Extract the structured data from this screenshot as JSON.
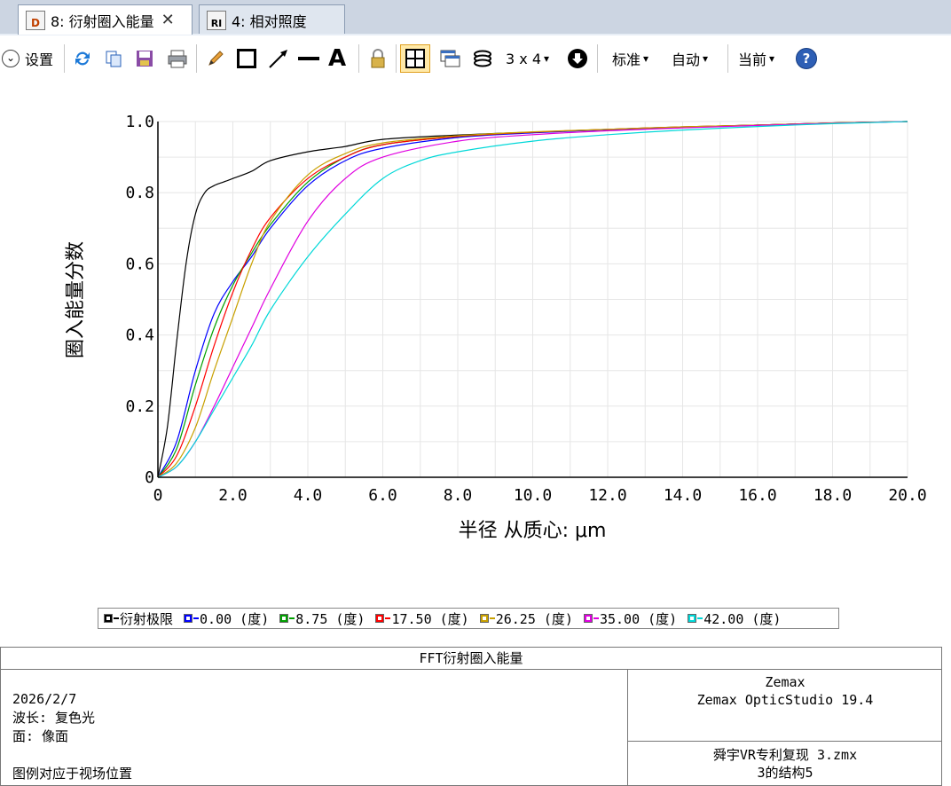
{
  "tabs": [
    {
      "icon": "D",
      "label": "8: 衍射圈入能量",
      "close": "✕"
    },
    {
      "icon": "RI",
      "label": "4: 相对照度"
    }
  ],
  "toolbar": {
    "settings_label": "设置",
    "grid_label": "3 x 4",
    "standard_label": "标准",
    "auto_label": "自动",
    "current_label": "当前",
    "dropdown_arrow": "▾",
    "text_tool": "A",
    "help": "?"
  },
  "chart_data": {
    "type": "line",
    "title": "",
    "xlabel": "半径  从质心: μm",
    "ylabel": "圈入能量分数",
    "xlim": [
      0,
      20
    ],
    "ylim": [
      0,
      1
    ],
    "grid": true,
    "x_ticks": [
      "0",
      "2.0",
      "4.0",
      "6.0",
      "8.0",
      "10.0",
      "12.0",
      "14.0",
      "16.0",
      "18.0",
      "20.0"
    ],
    "y_ticks": [
      "0",
      "0.2",
      "0.4",
      "0.6",
      "0.8",
      "1.0"
    ],
    "series": [
      {
        "name": "衍射极限",
        "color": "#000000",
        "x": [
          0,
          0.25,
          0.5,
          0.75,
          1,
          1.25,
          1.5,
          1.75,
          2,
          2.5,
          3,
          4,
          5,
          6,
          8,
          10,
          12,
          14,
          16,
          18,
          20
        ],
        "y": [
          0,
          0.14,
          0.38,
          0.6,
          0.74,
          0.8,
          0.82,
          0.83,
          0.84,
          0.86,
          0.89,
          0.915,
          0.93,
          0.95,
          0.962,
          0.97,
          0.977,
          0.984,
          0.99,
          0.996,
          1.0
        ]
      },
      {
        "name": "0.00 (度)",
        "color": "#0000ff",
        "x": [
          0,
          0.5,
          1,
          1.5,
          2,
          2.5,
          3,
          4,
          5,
          6,
          8,
          10,
          12,
          14,
          16,
          18,
          20
        ],
        "y": [
          0,
          0.1,
          0.3,
          0.46,
          0.55,
          0.62,
          0.7,
          0.82,
          0.89,
          0.925,
          0.955,
          0.968,
          0.977,
          0.984,
          0.99,
          0.996,
          1.0
        ]
      },
      {
        "name": "8.75 (度)",
        "color": "#00a000",
        "x": [
          0,
          0.5,
          1,
          1.5,
          2,
          2.5,
          3,
          4,
          5,
          6,
          8,
          10,
          12,
          14,
          16,
          18,
          20
        ],
        "y": [
          0,
          0.08,
          0.26,
          0.42,
          0.54,
          0.63,
          0.71,
          0.83,
          0.9,
          0.935,
          0.958,
          0.97,
          0.978,
          0.985,
          0.99,
          0.996,
          1.0
        ]
      },
      {
        "name": "17.50 (度)",
        "color": "#ff0000",
        "x": [
          0,
          0.5,
          1,
          1.5,
          2,
          2.5,
          3,
          4,
          5,
          6,
          8,
          10,
          12,
          14,
          16,
          18,
          20
        ],
        "y": [
          0,
          0.06,
          0.2,
          0.37,
          0.52,
          0.64,
          0.73,
          0.84,
          0.9,
          0.935,
          0.958,
          0.97,
          0.978,
          0.985,
          0.99,
          0.996,
          1.0
        ]
      },
      {
        "name": "26.25 (度)",
        "color": "#c8a000",
        "x": [
          0,
          0.5,
          1,
          1.5,
          2,
          2.5,
          3,
          4,
          5,
          6,
          8,
          10,
          12,
          14,
          16,
          18,
          20
        ],
        "y": [
          0,
          0.04,
          0.14,
          0.3,
          0.45,
          0.6,
          0.72,
          0.85,
          0.91,
          0.94,
          0.96,
          0.971,
          0.978,
          0.985,
          0.99,
          0.996,
          1.0
        ]
      },
      {
        "name": "35.00 (度)",
        "color": "#e000e0",
        "x": [
          0,
          0.5,
          1,
          1.5,
          2,
          2.5,
          3,
          4,
          5,
          6,
          8,
          10,
          12,
          14,
          16,
          18,
          20
        ],
        "y": [
          0,
          0.03,
          0.1,
          0.2,
          0.31,
          0.42,
          0.53,
          0.72,
          0.84,
          0.9,
          0.945,
          0.963,
          0.974,
          0.982,
          0.989,
          0.995,
          1.0
        ]
      },
      {
        "name": "42.00 (度)",
        "color": "#00d8d8",
        "x": [
          0,
          0.5,
          1,
          1.5,
          2,
          2.5,
          3,
          4,
          5,
          6,
          7,
          8,
          10,
          12,
          14,
          16,
          18,
          20
        ],
        "y": [
          0,
          0.03,
          0.1,
          0.19,
          0.28,
          0.37,
          0.47,
          0.62,
          0.74,
          0.84,
          0.89,
          0.915,
          0.945,
          0.963,
          0.976,
          0.986,
          0.994,
          1.0
        ]
      }
    ]
  },
  "info": {
    "title": "FFT衍射圈入能量",
    "date": "2026/2/7",
    "wavelength": "波长: 复色光",
    "surface": "面: 像面",
    "legend_note": "图例对应于视场位置",
    "company": "Zemax",
    "product": "Zemax OpticStudio 19.4",
    "file": "舜宇VR专利复现 3.zmx",
    "config": "3的结构5"
  }
}
